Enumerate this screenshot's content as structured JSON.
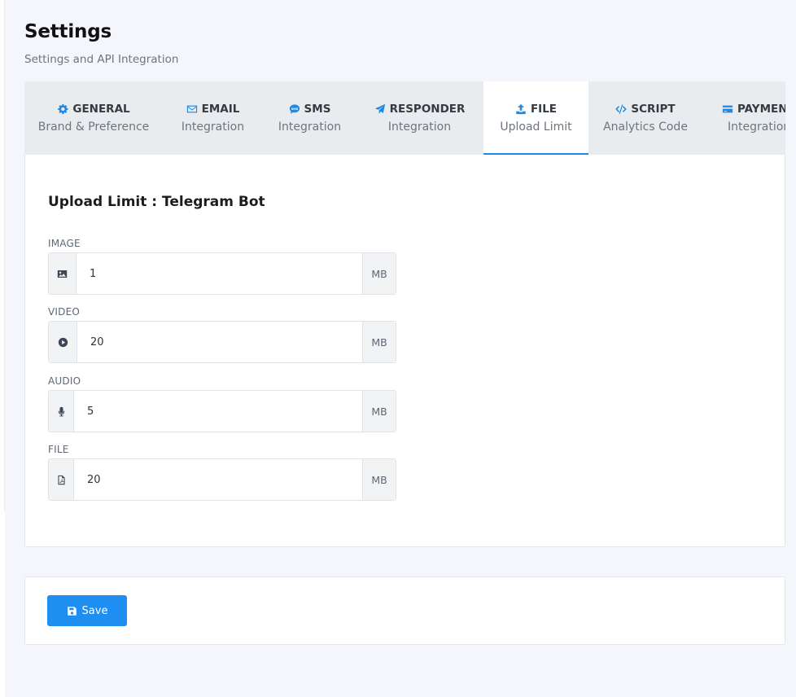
{
  "page": {
    "title": "Settings",
    "subtitle": "Settings and API Integration"
  },
  "tabs": [
    {
      "icon": "gear-icon",
      "label": "GENERAL",
      "sub": "Brand & Preference",
      "active": false
    },
    {
      "icon": "envelope-icon",
      "label": "EMAIL",
      "sub": "Integration",
      "active": false
    },
    {
      "icon": "sms-icon",
      "label": "SMS",
      "sub": "Integration",
      "active": false
    },
    {
      "icon": "paper-plane-icon",
      "label": "RESPONDER",
      "sub": "Integration",
      "active": false
    },
    {
      "icon": "upload-icon",
      "label": "FILE",
      "sub": "Upload Limit",
      "active": true
    },
    {
      "icon": "code-icon",
      "label": "SCRIPT",
      "sub": "Analytics Code",
      "active": false
    },
    {
      "icon": "credit-card-icon",
      "label": "PAYMENT",
      "sub": "Integration",
      "active": false
    }
  ],
  "upload_limit": {
    "title": "Upload Limit : Telegram Bot",
    "unit": "MB",
    "fields": [
      {
        "label": "IMAGE",
        "icon": "image-icon",
        "value": "1"
      },
      {
        "label": "VIDEO",
        "icon": "play-circle-icon",
        "value": "20"
      },
      {
        "label": "AUDIO",
        "icon": "microphone-icon",
        "value": "5"
      },
      {
        "label": "FILE",
        "icon": "file-pdf-icon",
        "value": "20"
      }
    ]
  },
  "actions": {
    "save_label": "Save"
  },
  "colors": {
    "accent": "#1e88e5",
    "button": "#1e8ef0",
    "tab_bar": "#e9ecef",
    "page_bg": "#f4f6fb"
  }
}
